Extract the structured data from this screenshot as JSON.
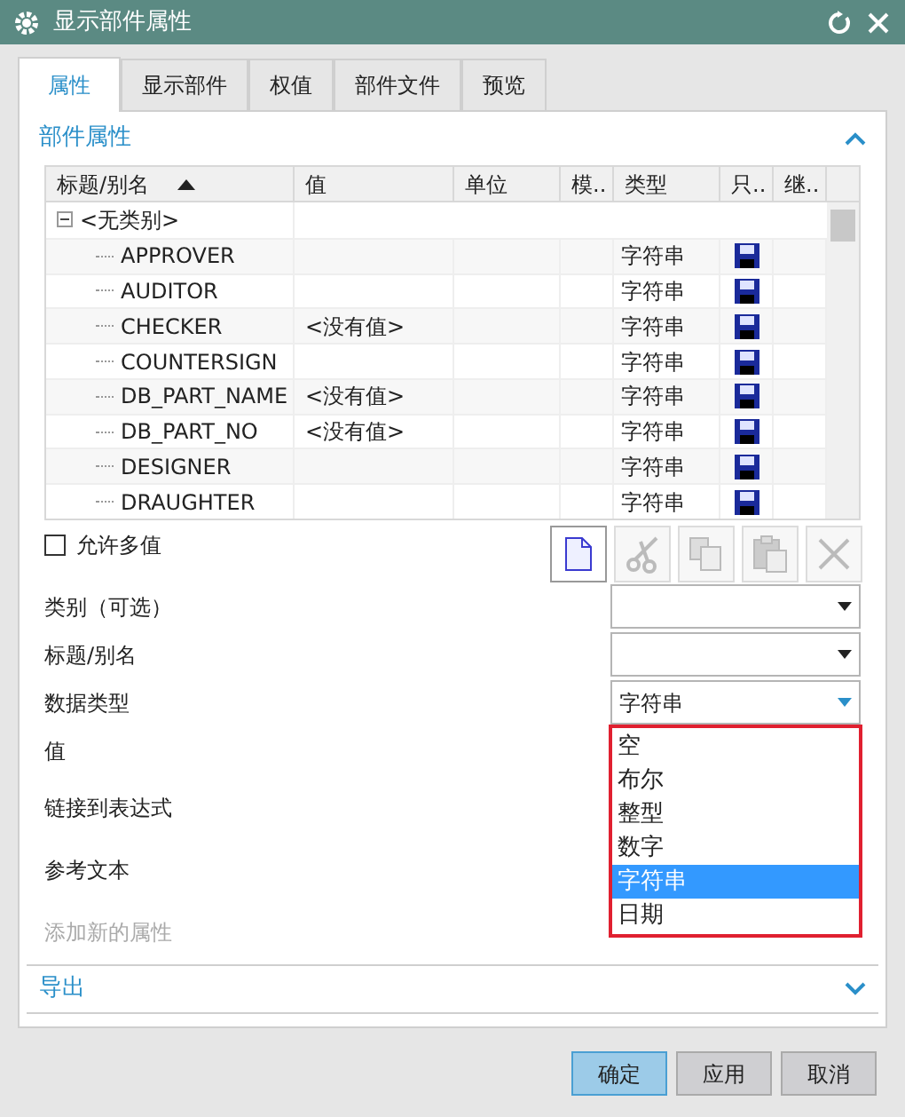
{
  "window": {
    "title": "显示部件属性"
  },
  "tabs": [
    {
      "label": "属性",
      "selected": true
    },
    {
      "label": "显示部件",
      "selected": false
    },
    {
      "label": "权值",
      "selected": false
    },
    {
      "label": "部件文件",
      "selected": false
    },
    {
      "label": "预览",
      "selected": false
    }
  ],
  "section": {
    "title": "部件属性",
    "expanded": true
  },
  "table": {
    "columns": [
      {
        "label": "标题/别名",
        "sorted": true
      },
      {
        "label": "值",
        "sorted": false
      },
      {
        "label": "单位",
        "sorted": false
      },
      {
        "label": "模..",
        "sorted": false
      },
      {
        "label": "类型",
        "sorted": false
      },
      {
        "label": "只..",
        "sorted": false
      },
      {
        "label": "继..",
        "sorted": false
      }
    ],
    "group": {
      "label": "<无类别>",
      "expanded": true
    },
    "rows": [
      {
        "title": "APPROVER",
        "type": "字符串"
      },
      {
        "title": "AUDITOR",
        "type": "字符串"
      },
      {
        "title": "CHECKER",
        "value": "<没有值>",
        "type": "字符串"
      },
      {
        "title": "COUNTERSIGN",
        "type": "字符串"
      },
      {
        "title": "DB_PART_NAME",
        "value": "<没有值>",
        "type": "字符串"
      },
      {
        "title": "DB_PART_NO",
        "value": "<没有值>",
        "type": "字符串"
      },
      {
        "title": "DESIGNER",
        "type": "字符串"
      },
      {
        "title": "DRAUGHTER",
        "type": "字符串"
      }
    ]
  },
  "allow_multiple": {
    "label": "允许多值",
    "checked": false
  },
  "toolbar": [
    {
      "kind": "new",
      "disabled": false
    },
    {
      "kind": "cut",
      "disabled": true
    },
    {
      "kind": "copy",
      "disabled": true
    },
    {
      "kind": "paste",
      "disabled": true
    },
    {
      "kind": "delete",
      "disabled": true
    }
  ],
  "fields": [
    {
      "label": "类别（可选）",
      "kind": "dropdown",
      "disabled": false
    },
    {
      "label": "标题/别名",
      "kind": "dropdown",
      "disabled": false
    },
    {
      "label": "数据类型",
      "kind": "dropdown",
      "value": "字符串",
      "disabled": false
    },
    {
      "label": "值",
      "kind": "label",
      "disabled": false
    },
    {
      "label": "链接到表达式",
      "kind": "label",
      "disabled": false
    },
    {
      "label": "参考文本",
      "kind": "label",
      "disabled": false
    },
    {
      "label": "添加新的属性",
      "kind": "label",
      "disabled": true
    }
  ],
  "dropdown_list": {
    "items": [
      {
        "label": "空",
        "selected": false
      },
      {
        "label": "布尔",
        "selected": false
      },
      {
        "label": "整型",
        "selected": false
      },
      {
        "label": "数字",
        "selected": false
      },
      {
        "label": "字符串",
        "selected": true
      },
      {
        "label": "日期",
        "selected": false
      }
    ]
  },
  "export_section": {
    "title": "导出",
    "expanded": false
  },
  "buttons": [
    {
      "label": "确定",
      "primary": true
    },
    {
      "label": "应用",
      "primary": false
    },
    {
      "label": "取消",
      "primary": false
    }
  ]
}
